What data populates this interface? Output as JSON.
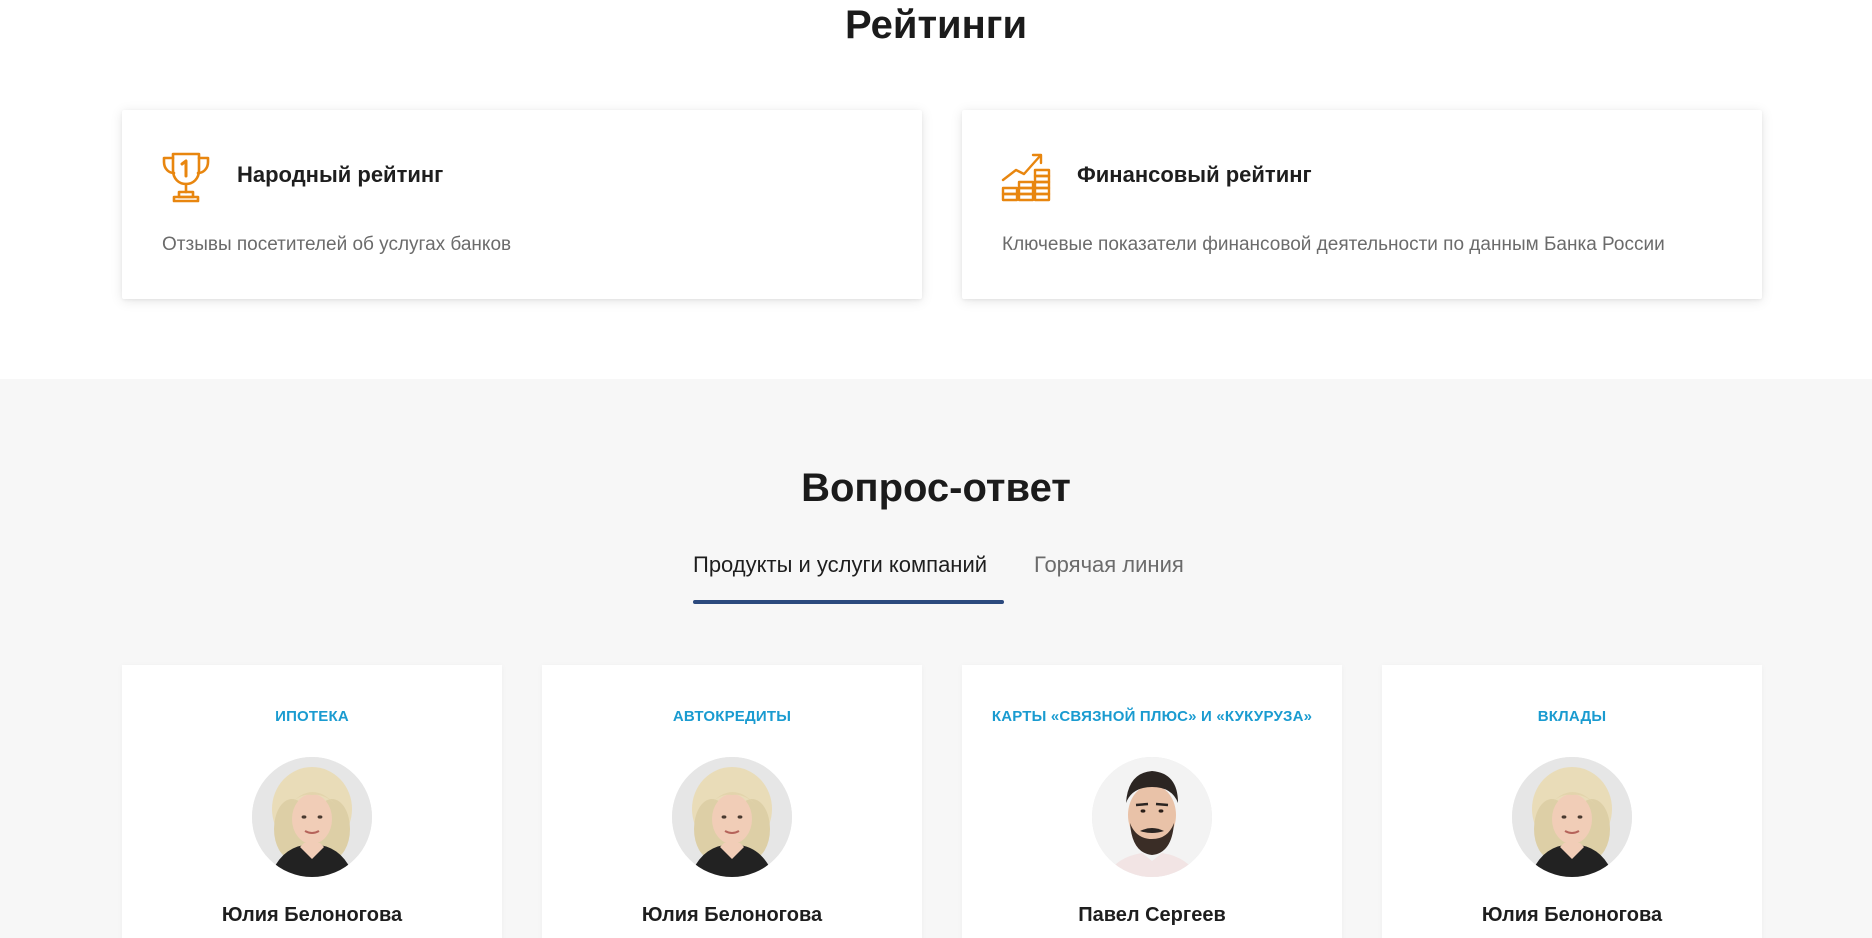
{
  "ratings": {
    "title": "Рейтинги",
    "cards": [
      {
        "name": "Народный рейтинг",
        "description": "Отзывы посетителей об услугах банков",
        "icon": "trophy-icon"
      },
      {
        "name": "Финансовый рейтинг",
        "description": "Ключевые показатели финансовой деятельности по данным Банка России",
        "icon": "coins-growth-icon"
      }
    ],
    "icon_color": "#e8860f"
  },
  "qa": {
    "title": "Вопрос-ответ",
    "tabs": [
      {
        "label": "Продукты и услуги компаний",
        "active": true
      },
      {
        "label": "Горячая линия",
        "active": false
      }
    ],
    "tab_accent": "#2c4a7e",
    "category_color": "#1a9bd0",
    "experts": [
      {
        "category": "Ипотека",
        "name": "Юлия Белоногова"
      },
      {
        "category": "Автокредиты",
        "name": "Юлия Белоногова"
      },
      {
        "category": "Карты «Связной Плюс» и «Кукуруза»",
        "name": "Павел Сергеев"
      },
      {
        "category": "Вклады",
        "name": "Юлия Белоногова"
      }
    ]
  }
}
